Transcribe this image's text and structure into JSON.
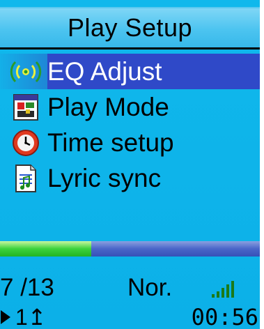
{
  "header": {
    "title": "Play Setup"
  },
  "menu": {
    "items": [
      {
        "label": "EQ Adjust",
        "icon": "equalizer-icon",
        "selected": true
      },
      {
        "label": "Play Mode",
        "icon": "play-mode-icon",
        "selected": false
      },
      {
        "label": "Time setup",
        "icon": "clock-icon",
        "selected": false
      },
      {
        "label": "Lyric sync",
        "icon": "lyric-document-icon",
        "selected": false
      }
    ]
  },
  "progress": {
    "fraction": 0.35
  },
  "status": {
    "track_count": "7 /13",
    "mode": "Nor.",
    "volume_icon": "volume-bars-icon",
    "play_icon": "play-icon",
    "repeat": "1↥",
    "time": "00:56"
  },
  "colors": {
    "background": "#10b8ec",
    "selection": "#2f49c8",
    "progress_fill": "#3cd23c",
    "progress_track": "#4a66c8"
  }
}
